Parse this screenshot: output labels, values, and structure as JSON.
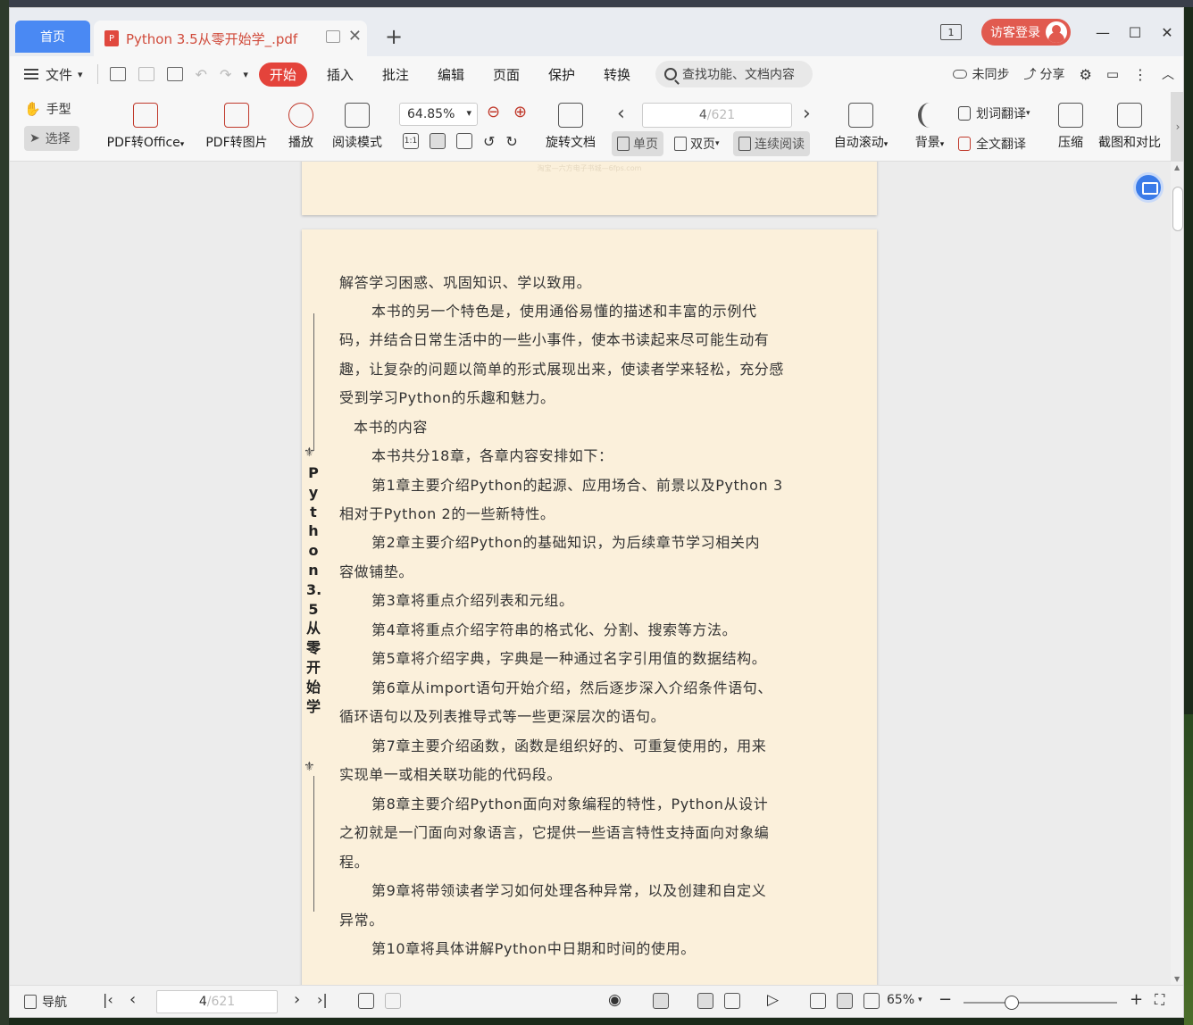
{
  "titlebar": {
    "home_tab": "首页",
    "doc_tab": "Python 3.5从零开始学_.pdf",
    "pages_badge": "1",
    "login_label": "访客登录",
    "new_tab": "+",
    "minimize": "—",
    "maximize": "☐",
    "close": "✕"
  },
  "menubar": {
    "file": "文件",
    "items": [
      "开始",
      "插入",
      "批注",
      "编辑",
      "页面",
      "保护",
      "转换"
    ],
    "search_placeholder": "查找功能、文档内容",
    "sync": "未同步",
    "share": "分享"
  },
  "toolbar": {
    "hand": "手型",
    "select": "选择",
    "pdf_to_office": "PDF转Office",
    "pdf_to_image": "PDF转图片",
    "play": "播放",
    "read_mode": "阅读模式",
    "zoom": "64.85%",
    "rotate": "旋转文档",
    "page_current": "4",
    "page_total": "/621",
    "single": "单页",
    "double": "双页",
    "continuous": "连续阅读",
    "auto_scroll": "自动滚动",
    "background": "背景",
    "word_translate": "划词翻译",
    "full_translate": "全文翻译",
    "compress": "压缩",
    "screenshot": "截图和对比"
  },
  "document": {
    "watermark": "淘宝—六方电子书城—6fps.com",
    "spine_title": "Python 3.5从零开始学",
    "lines": [
      "解答学习困惑、巩固知识、学以致用。",
      "本书的另一个特色是，使用通俗易懂的描述和丰富的示例代",
      "码，并结合日常生活中的一些小事件，使本书读起来尽可能生动有",
      "趣，让复杂的问题以简单的形式展现出来，使读者学来轻松，充分感",
      "受到学习Python的乐趣和魅力。",
      "本书的内容",
      "本书共分18章，各章内容安排如下：",
      "第1章主要介绍Python的起源、应用场合、前景以及Python 3",
      "相对于Python 2的一些新特性。",
      "第2章主要介绍Python的基础知识，为后续章节学习相关内",
      "容做铺垫。",
      "第3章将重点介绍列表和元组。",
      "第4章将重点介绍字符串的格式化、分割、搜索等方法。",
      "第5章将介绍字典，字典是一种通过名字引用值的数据结构。",
      "第6章从import语句开始介绍，然后逐步深入介绍条件语句、",
      "循环语句以及列表推导式等一些更深层次的语句。",
      "第7章主要介绍函数，函数是组织好的、可重复使用的，用来",
      "实现单一或相关联功能的代码段。",
      "第8章主要介绍Python面向对象编程的特性，Python从设计",
      "之初就是一门面向对象语言，它提供一些语言特性支持面向对象编",
      "程。",
      "第9章将带领读者学习如何处理各种异常，以及创建和自定义",
      "异常。",
      "第10章将具体讲解Python中日期和时间的使用。"
    ]
  },
  "statusbar": {
    "nav": "导航",
    "page_current": "4",
    "page_total": "/621",
    "zoom": "65%"
  }
}
